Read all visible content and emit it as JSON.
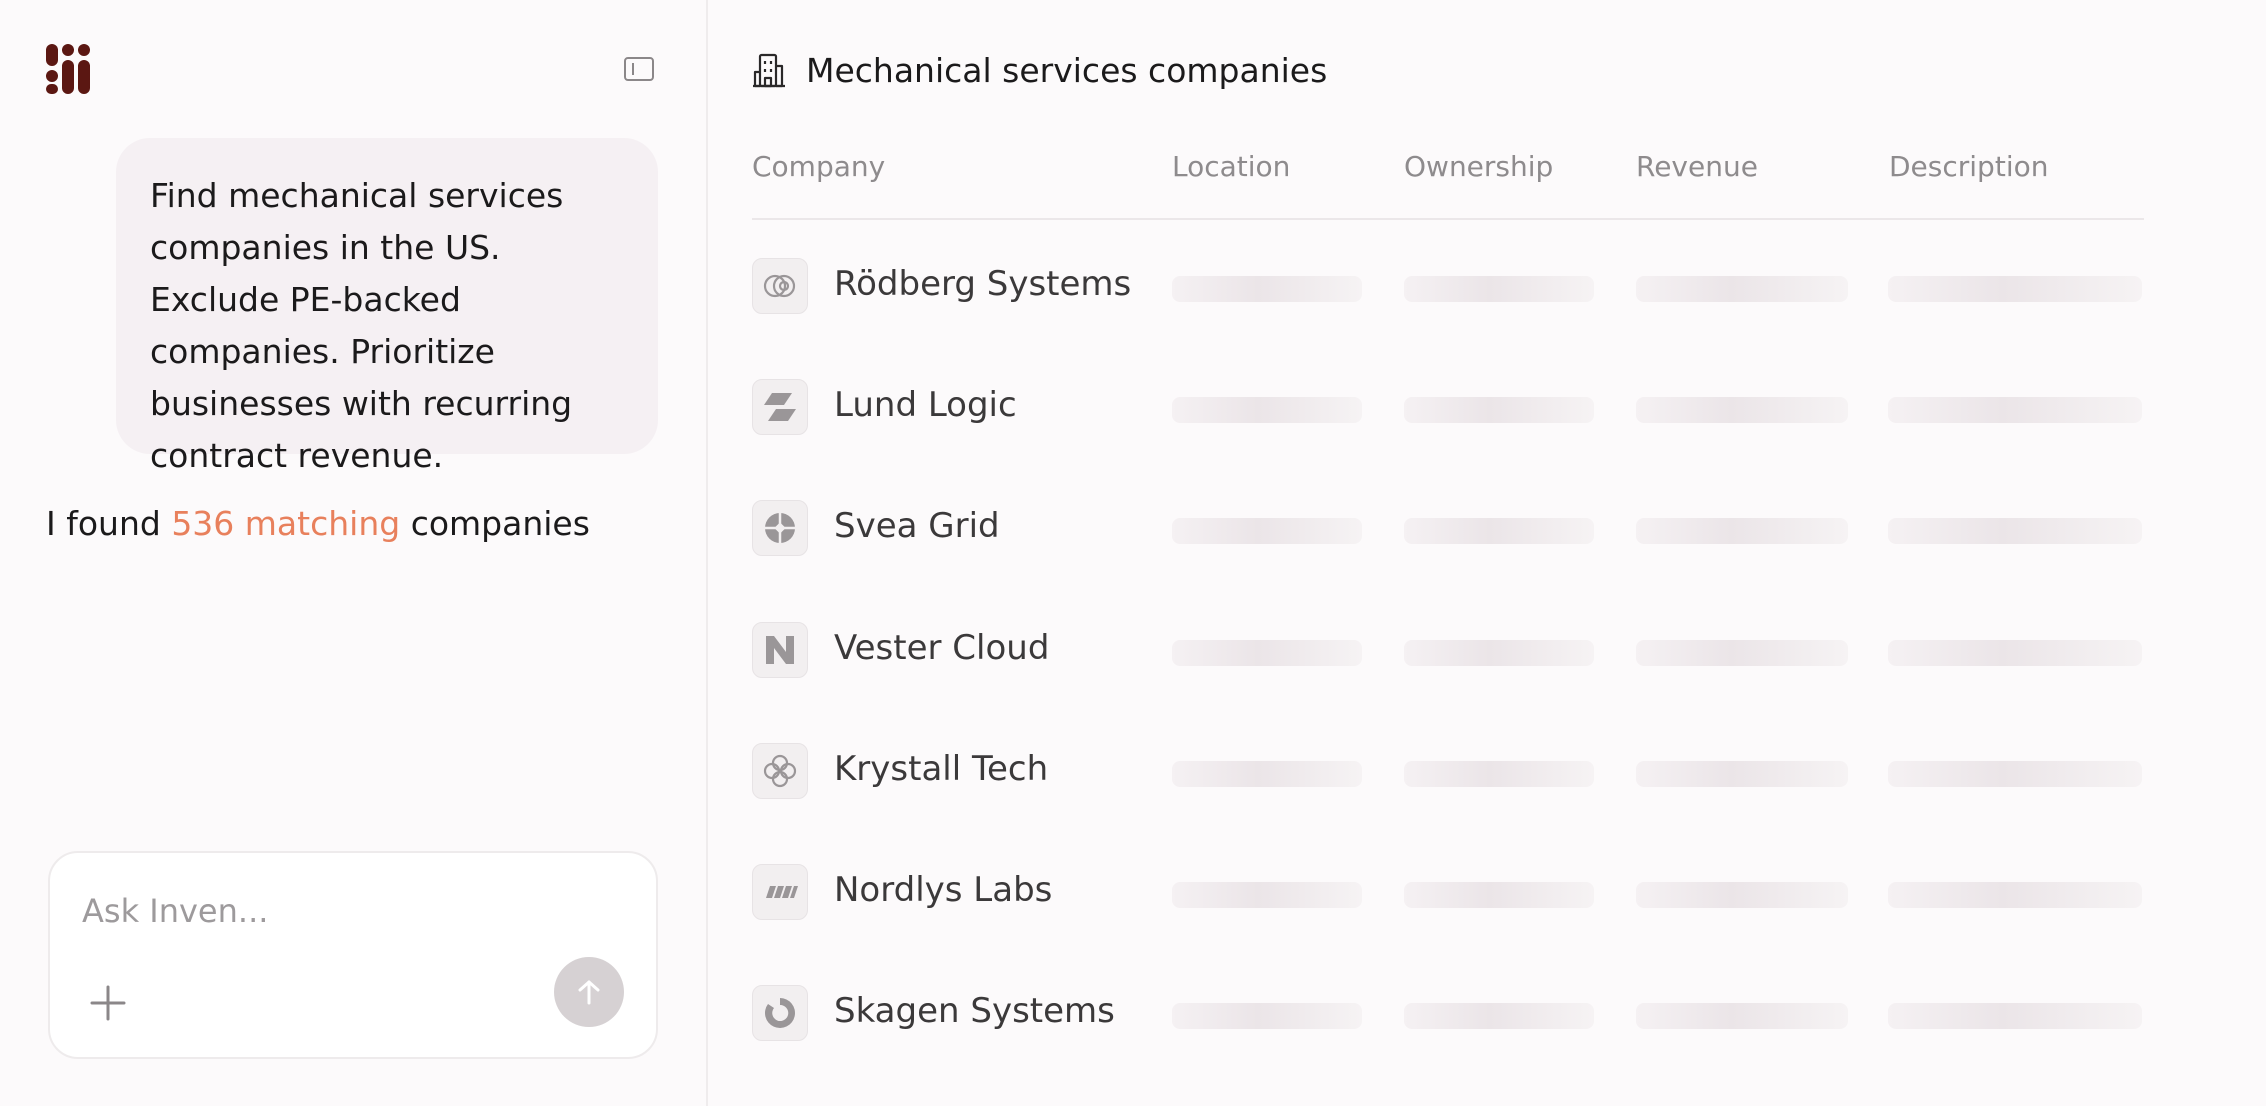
{
  "chat": {
    "user_message": "Find mechanical services companies in the US. Exclude PE-backed companies. Prioritize businesses with recurring contract revenue.",
    "reply_prefix": "I found",
    "reply_highlight": "536 matching",
    "reply_suffix": "companies",
    "composer_placeholder": "Ask Inven...",
    "highlight_color": "#e8805c"
  },
  "panel": {
    "title": "Mechanical services companies",
    "columns": [
      "Company",
      "Location",
      "Ownership",
      "Revenue",
      "Description"
    ]
  },
  "rows": [
    {
      "name": "Rödberg Systems",
      "logo": "rings-logo"
    },
    {
      "name": "Lund Logic",
      "logo": "stacked-slabs-logo"
    },
    {
      "name": "Svea Grid",
      "logo": "aperture-logo"
    },
    {
      "name": "Vester Cloud",
      "logo": "n-mark-logo"
    },
    {
      "name": "Krystall Tech",
      "logo": "clover-logo"
    },
    {
      "name": "Nordlys Labs",
      "logo": "slanted-stripes-logo"
    },
    {
      "name": "Skagen Systems",
      "logo": "swirl-logo"
    }
  ],
  "brand_color": "#5b1712"
}
